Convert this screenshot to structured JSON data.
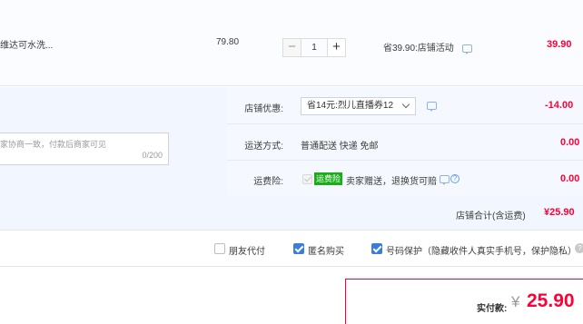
{
  "item": {
    "title": "维达可水洗...",
    "price": "79.80",
    "quantity": "1",
    "minus": "−",
    "plus": "+",
    "promo": "省39.90:店铺活动",
    "total": "39.90"
  },
  "options": {
    "discount_label": "店铺优惠:",
    "discount_selected": "省14元:烈儿直播券12",
    "discount_amount": "-14.00",
    "shipping_label": "运送方式:",
    "shipping_value": "普通配送 快递 免邮",
    "shipping_amount": "0.00",
    "insurance_label": "运费险:",
    "insurance_tag": "运费险",
    "insurance_text": "卖家赠送，退换货可赔",
    "insurance_amount": "0.00",
    "help_glyph": "?",
    "message_placeholder": "家协商一致，付款后商家可见",
    "message_count": "0/200"
  },
  "shop_total": {
    "label": "店铺合计(含运费)",
    "value": "¥25.90"
  },
  "checkboxes": [
    {
      "label": "朋友代付",
      "checked": false
    },
    {
      "label": "匿名购买",
      "checked": true
    },
    {
      "label": "号码保护（隐藏收件人真实手机号，保护隐私）",
      "checked": true
    }
  ],
  "q_glyph": "?",
  "payment": {
    "label": "实付款:",
    "currency": "¥",
    "value": "25.90"
  },
  "colors": {
    "accent": "#ff0036",
    "brand_blue": "#3a7ed8",
    "panel_bg": "#f2f7ff"
  }
}
